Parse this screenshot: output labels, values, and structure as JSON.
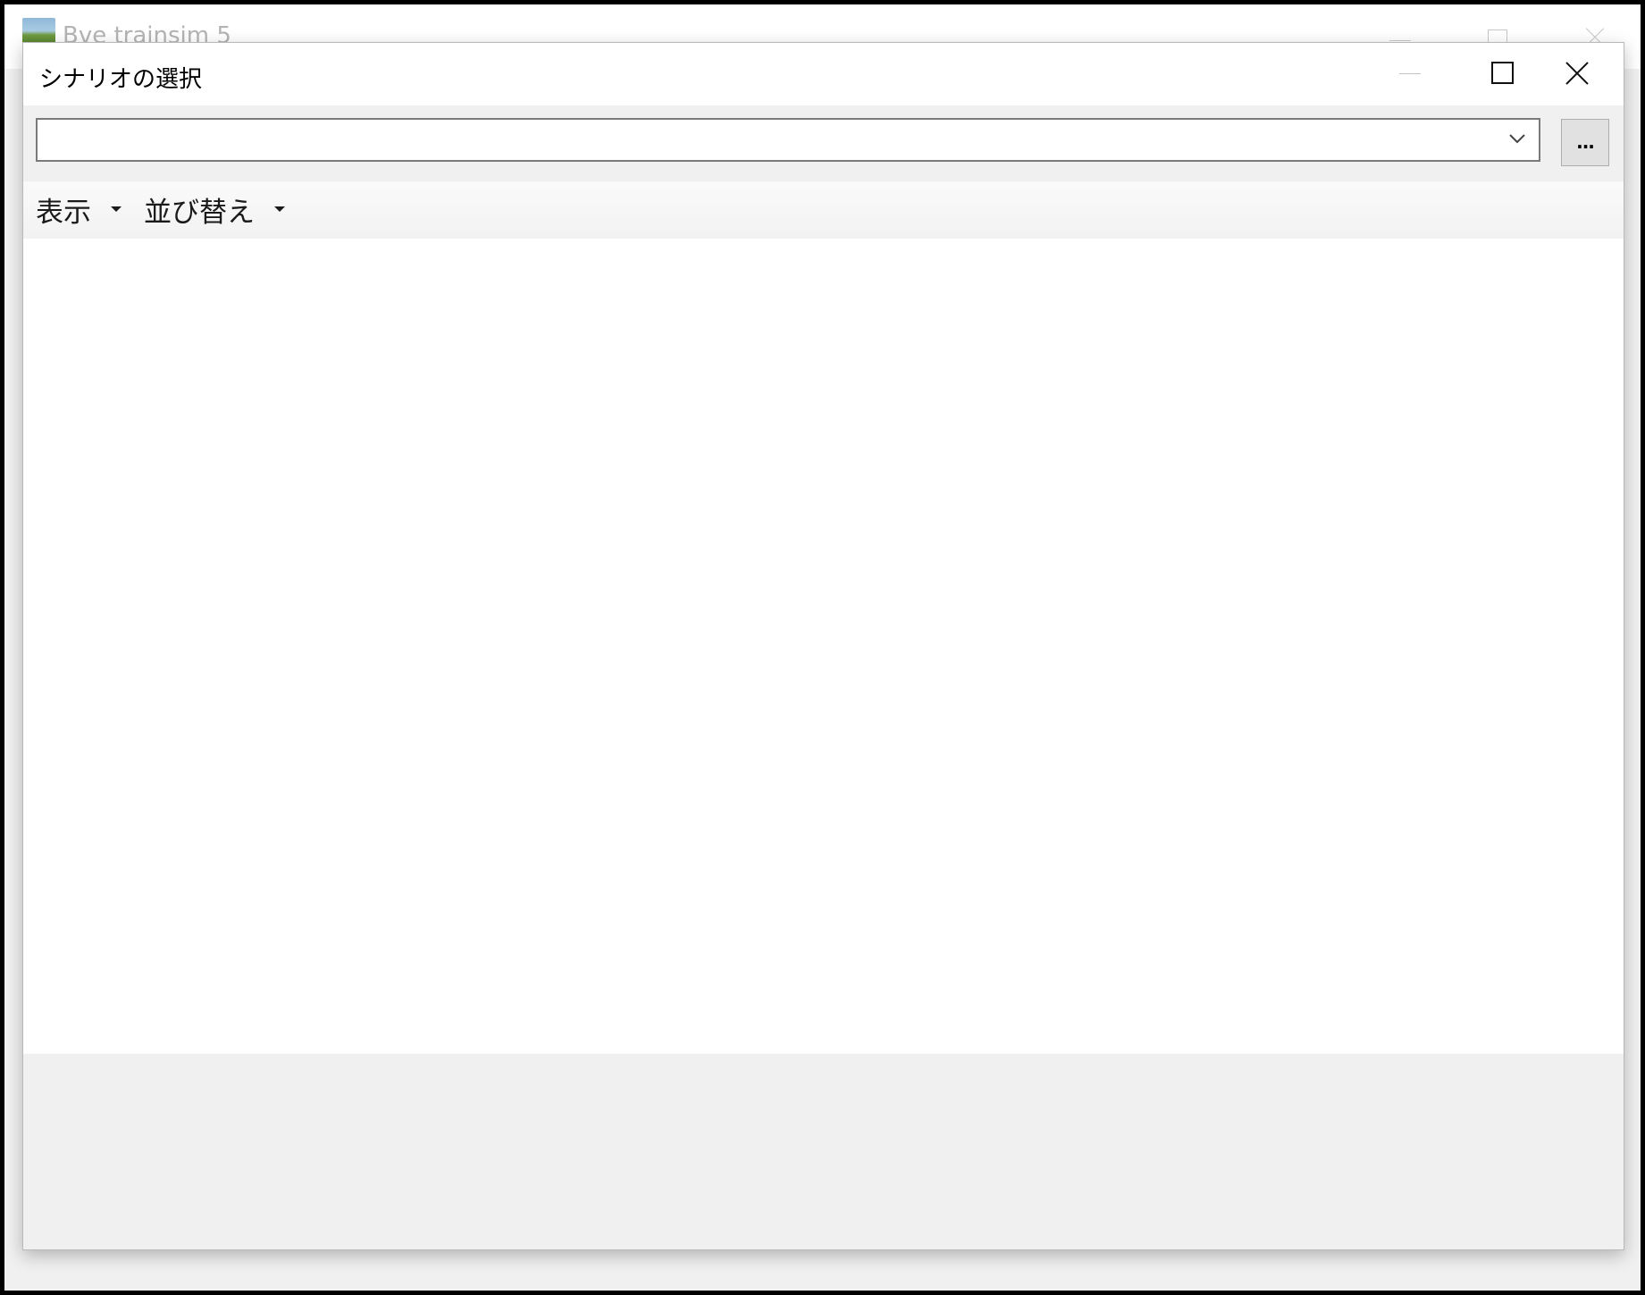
{
  "parent_window": {
    "title": "Bve trainsim 5",
    "icon": "landscape-app-icon",
    "controls": [
      "minimize-icon",
      "maximize-icon",
      "close-icon"
    ]
  },
  "dialog": {
    "title": "シナリオの選択",
    "controls": [
      "minimize-icon",
      "maximize-icon",
      "close-icon"
    ],
    "path": {
      "value": "",
      "placeholder": "",
      "browse_label": "..."
    },
    "toolbar": {
      "view_label": "表示",
      "sort_label": "並び替え"
    },
    "scenario_list": []
  }
}
